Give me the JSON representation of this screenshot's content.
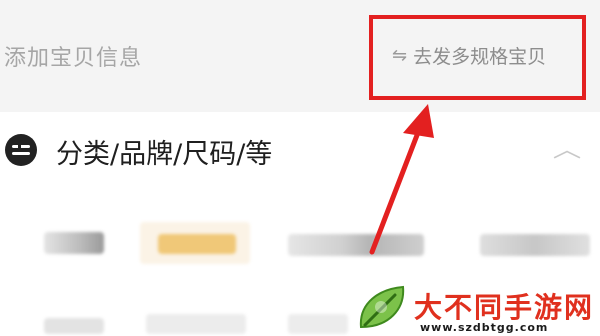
{
  "section": {
    "title": "添加宝贝信息"
  },
  "multi_spec": {
    "icon": "swap-arrows-icon",
    "label": "去发多规格宝贝"
  },
  "category": {
    "icon": "list-icon",
    "label": "分类/品牌/尺码/等"
  },
  "chips": {
    "row1_colors": [
      "#d9d9d9",
      "#f0c878",
      "#dcdcdc",
      "#d8d8d8"
    ]
  },
  "annotation": {
    "box_color": "#e32020",
    "arrow_color": "#e32020"
  },
  "watermark": {
    "title": "大不同手游网",
    "url": "www.szdbtgg.com"
  }
}
